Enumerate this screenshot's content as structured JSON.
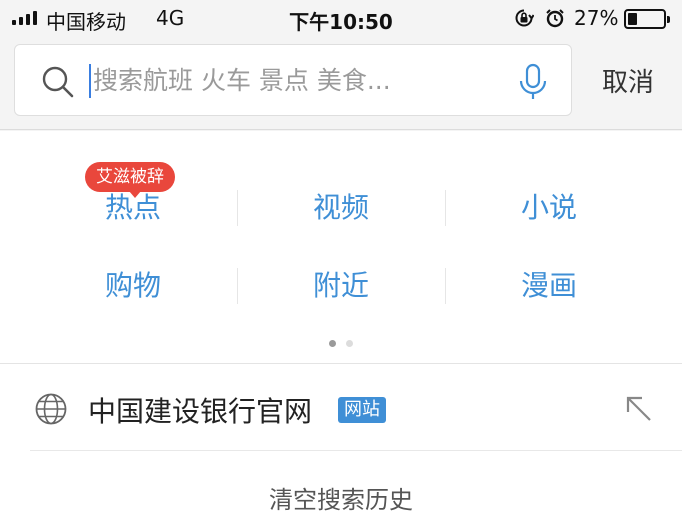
{
  "status_bar": {
    "carrier": "中国移动",
    "network": "4G",
    "time": "下午10:50",
    "battery_percent": "27%",
    "battery_level": 0.27
  },
  "search": {
    "placeholder": "搜索航班 火车 景点 美食...",
    "value": "",
    "cancel_label": "取消"
  },
  "categories": {
    "hot_badge": "艾滋被辞",
    "items": [
      {
        "label": "热点"
      },
      {
        "label": "视频"
      },
      {
        "label": "小说"
      },
      {
        "label": "购物"
      },
      {
        "label": "附近"
      },
      {
        "label": "漫画"
      }
    ],
    "page_count": 2,
    "active_page": 1
  },
  "history": {
    "items": [
      {
        "title": "中国建设银行官网",
        "badge": "网站"
      }
    ],
    "clear_label": "清空搜索历史"
  },
  "colors": {
    "accent": "#3f8fd6",
    "badge_red": "#e9473c",
    "background": "#f4f4f4"
  }
}
